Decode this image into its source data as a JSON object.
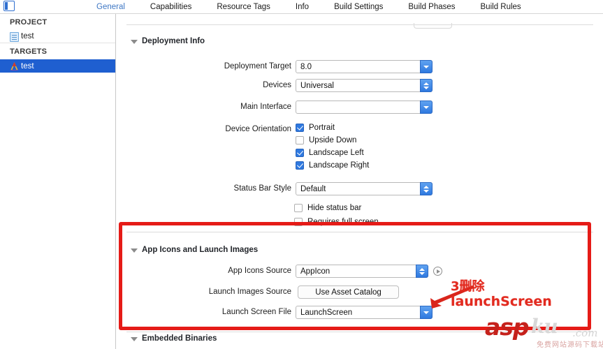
{
  "window": {
    "sidebar_toggle_icon": "sidebar-toggle-icon"
  },
  "tabs": [
    {
      "label": "General",
      "active": true
    },
    {
      "label": "Capabilities",
      "active": false
    },
    {
      "label": "Resource Tags",
      "active": false
    },
    {
      "label": "Info",
      "active": false
    },
    {
      "label": "Build Settings",
      "active": false
    },
    {
      "label": "Build Phases",
      "active": false
    },
    {
      "label": "Build Rules",
      "active": false
    }
  ],
  "sidebar": {
    "groups": [
      {
        "title": "PROJECT",
        "items": [
          {
            "label": "test",
            "icon": "document-icon",
            "selected": false
          }
        ]
      },
      {
        "title": "TARGETS",
        "items": [
          {
            "label": "test",
            "icon": "app-target-icon",
            "selected": true
          }
        ]
      }
    ]
  },
  "sections": {
    "deployment_info": {
      "title": "Deployment Info",
      "rows": {
        "deployment_target": {
          "label": "Deployment Target",
          "value": "8.0",
          "control": "combo-box"
        },
        "devices": {
          "label": "Devices",
          "value": "Universal",
          "control": "popup-button"
        },
        "main_interface": {
          "label": "Main Interface",
          "value": "",
          "control": "combo-box"
        },
        "device_orientation": {
          "label": "Device Orientation",
          "options": [
            {
              "label": "Portrait",
              "checked": true
            },
            {
              "label": "Upside Down",
              "checked": false
            },
            {
              "label": "Landscape Left",
              "checked": true
            },
            {
              "label": "Landscape Right",
              "checked": true
            }
          ]
        },
        "status_bar_style": {
          "label": "Status Bar Style",
          "value": "Default",
          "control": "popup-button"
        },
        "extra_options": [
          {
            "label": "Hide status bar",
            "checked": false
          },
          {
            "label": "Requires full screen",
            "checked": false
          }
        ]
      }
    },
    "app_icons_and_launch_images": {
      "title": "App Icons and Launch Images",
      "rows": {
        "app_icons_source": {
          "label": "App Icons Source",
          "value": "AppIcon",
          "control": "popup-button",
          "has_reveal_button": true
        },
        "launch_images_source": {
          "label": "Launch Images Source",
          "button_label": "Use Asset Catalog",
          "control": "push-button"
        },
        "launch_screen_file": {
          "label": "Launch Screen File",
          "value": "LaunchScreen",
          "control": "combo-box"
        }
      }
    },
    "embedded_binaries": {
      "title": "Embedded Binaries"
    }
  },
  "annotations": {
    "highlight_color": "#e51b17",
    "arrow_color": "#d9261c",
    "text_color": "#e22a1f",
    "line1": "3删除",
    "line2": "launchScreen"
  },
  "watermark": {
    "brand_primary": "asp",
    "brand_secondary": "ku",
    "brand_tld": ".com",
    "subtitle": "免费网站源码下载站",
    "primary_color": "#c5211b"
  }
}
